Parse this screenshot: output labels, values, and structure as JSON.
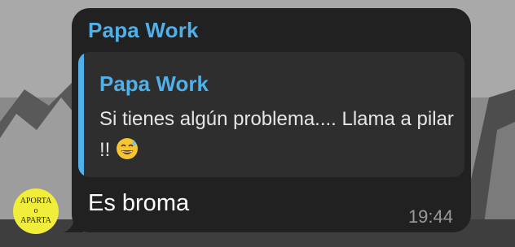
{
  "avatar": {
    "line1": "APORTA",
    "line2": "o",
    "line3": "APARTA"
  },
  "message": {
    "sender": "Papa Work",
    "reply": {
      "sender": "Papa Work",
      "text": "Si tienes algún problema.... Llama a pilar !!",
      "emoji": "sweat-smile-emoji"
    },
    "text": "Es broma",
    "time": "19:44"
  },
  "colors": {
    "bubble": "#212121",
    "reply_background": "#2e2e2e",
    "accent": "#4fb0ea",
    "avatar": "#f0ee3a"
  }
}
